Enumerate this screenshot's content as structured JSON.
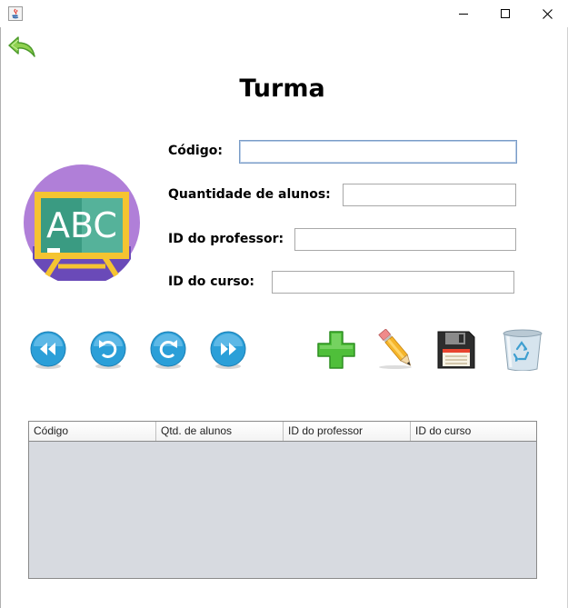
{
  "window": {
    "controls": [
      "minimize",
      "maximize",
      "close"
    ]
  },
  "page": {
    "title": "Turma"
  },
  "form": {
    "codigo_label": "Código:",
    "quantidade_label": "Quantidade de alunos:",
    "professor_label": "ID do professor:",
    "curso_label": "ID do curso:",
    "codigo_value": "",
    "quantidade_value": "",
    "professor_value": "",
    "curso_value": ""
  },
  "logo": {
    "text": "ABC",
    "colors": {
      "circle": "#b07fd8",
      "board": "#f5c431",
      "slate": "#3a9b82"
    }
  },
  "navigation": {
    "buttons": [
      "first",
      "previous",
      "next",
      "last"
    ],
    "color": "#2b9fd8"
  },
  "toolbar": {
    "buttons": [
      "add",
      "edit",
      "save",
      "delete"
    ]
  },
  "table": {
    "columns": [
      "Código",
      "Qtd. de alunos",
      "ID do professor",
      "ID do curso"
    ],
    "rows": []
  }
}
